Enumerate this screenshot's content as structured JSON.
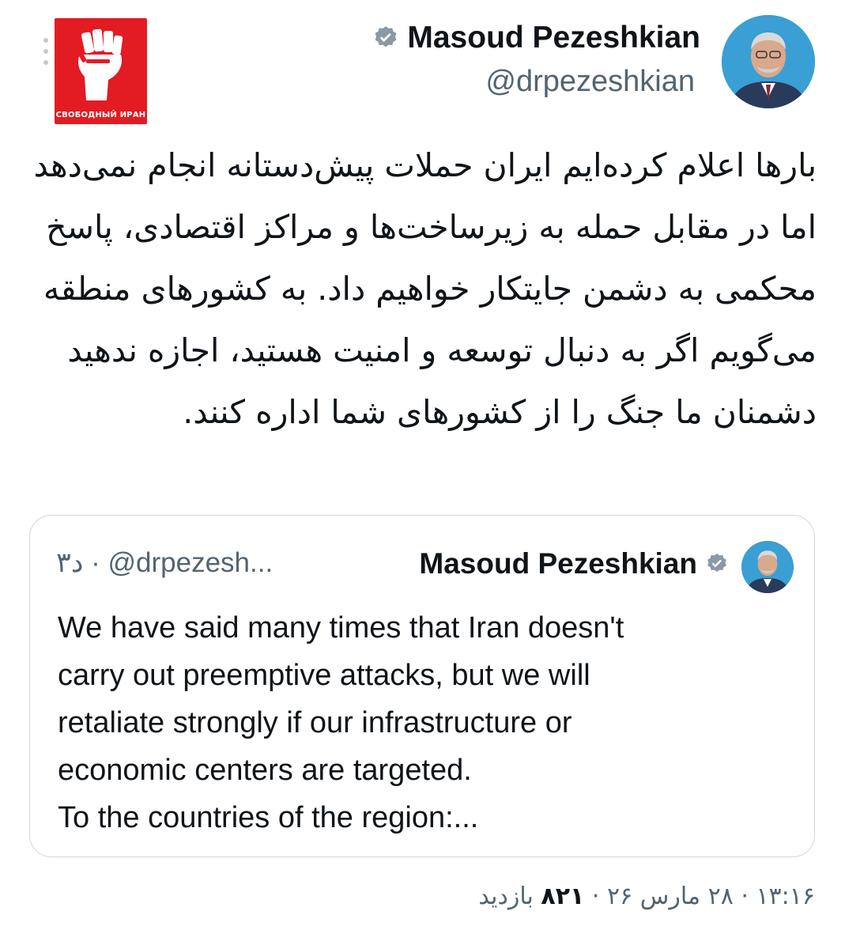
{
  "watermark": {
    "caption": "СВОБОДНЫЙ ИРАН",
    "bg_color": "#e31b23",
    "icon": "raised-fist-icon"
  },
  "tweet": {
    "author_name": "Masoud Pezeshkian",
    "handle": "@drpezeshkian",
    "verified_icon": "verified-badge-icon",
    "verified_color": "#8b98a5",
    "text": "بارها اعلام کرده‌ایم ایران حملات پیش‌دستانه انجام نمی‌دهد اما در مقابل حمله به زیرساخت‌ها و مراکز اقتصادی، پاسخ محکمی به دشمن جایتکار خواهیم داد. به کشورهای منطقه می‌گویم اگر به دنبال توسعه و امنیت هستید، اجازه ندهید دشمنان ما جنگ را از کشورهای شما اداره کنند."
  },
  "quoted_tweet": {
    "author_name": "Masoud Pezeshkian",
    "meta": "۳د · @drpezesh...",
    "lines": [
      "We have said many times that Iran doesn't",
      "carry out preemptive attacks, but we will",
      "retaliate strongly if our infrastructure or",
      "economic centers are targeted.",
      "To the countries of the region:..."
    ]
  },
  "footer": {
    "time_date": "۱۳:۱۶ · ۲۸ مارس ۲۶ ·",
    "views_count": "۸۲۱",
    "views_label": "بازدید"
  },
  "colors": {
    "text": "#0f1419",
    "secondary": "#536471",
    "border": "#cfd9de"
  }
}
